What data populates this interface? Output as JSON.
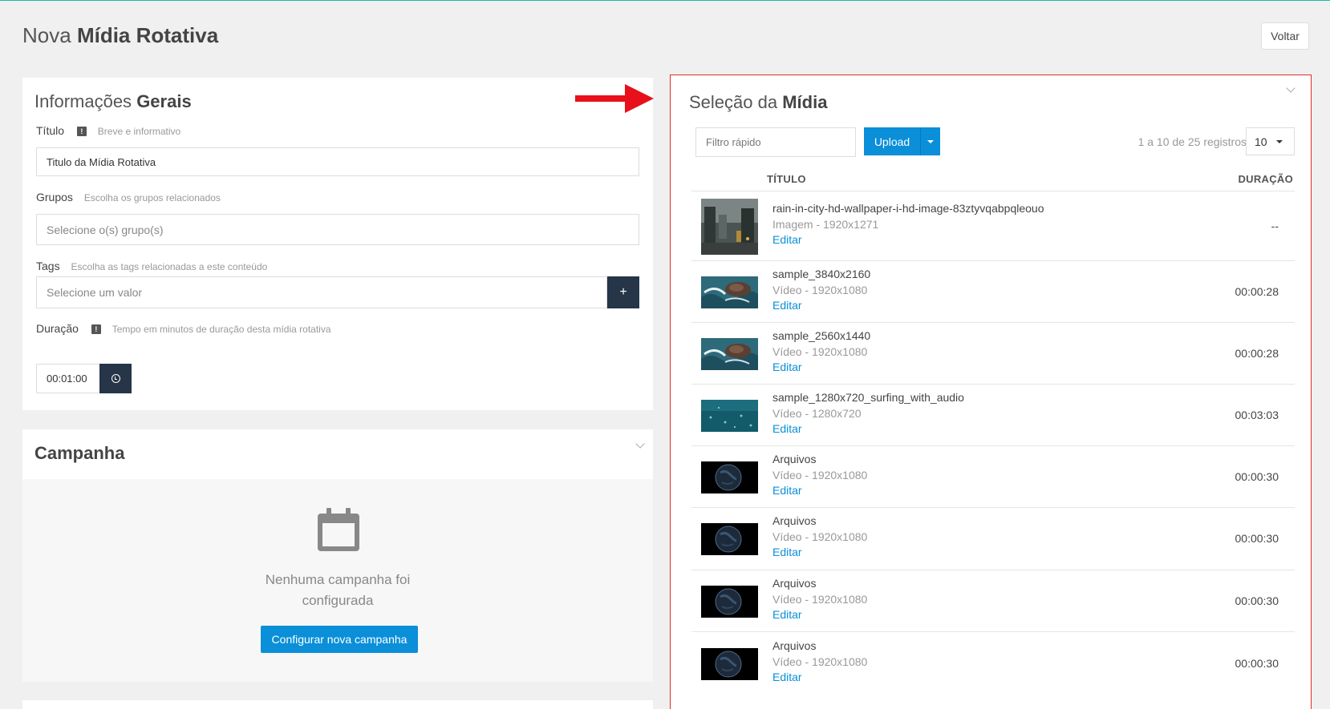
{
  "header": {
    "title_light": "Nova",
    "title_bold": "Mídia Rotativa",
    "back_label": "Voltar"
  },
  "general": {
    "title_light": "Informações",
    "title_bold": "Gerais",
    "titulo_label": "Título",
    "titulo_hint": "Breve e informativo",
    "titulo_value": "Titulo da Mídia Rotativa",
    "grupos_label": "Grupos",
    "grupos_hint": "Escolha os grupos relacionados",
    "grupos_placeholder": "Selecione o(s) grupo(s)",
    "tags_label": "Tags",
    "tags_hint": "Escolha as tags relacionadas a este conteúdo",
    "tags_placeholder": "Selecione um valor",
    "tags_add": "+",
    "duracao_label": "Duração",
    "duracao_hint": "Tempo em minutos de duração desta mídia rotativa",
    "duracao_value": "00:01:00",
    "info_glyph": "!"
  },
  "campaign": {
    "title": "Campanha",
    "empty_line1": "Nenhuma campanha foi",
    "empty_line2": "configurada",
    "configure_label": "Configurar nova campanha"
  },
  "media": {
    "title_light": "Seleção da",
    "title_bold": "Mídia",
    "filter_placeholder": "Filtro rápido",
    "upload_label": "Upload",
    "records_text": "1 a 10 de 25 registros",
    "per_page": "10",
    "col_title": "TÍTULO",
    "col_duration": "DURAÇÃO",
    "edit_label": "Editar",
    "items": [
      {
        "title": "rain-in-city-hd-wallpaper-i-hd-image-83ztyvqabpqleouo",
        "sub": "Imagem - 1920x1271",
        "duration": "--",
        "thumb": "city"
      },
      {
        "title": "sample_3840x2160",
        "sub": "Vídeo - 1920x1080",
        "duration": "00:00:28",
        "thumb": "waves"
      },
      {
        "title": "sample_2560x1440",
        "sub": "Vídeo - 1920x1080",
        "duration": "00:00:28",
        "thumb": "waves"
      },
      {
        "title": "sample_1280x720_surfing_with_audio",
        "sub": "Vídeo - 1280x720",
        "duration": "00:03:03",
        "thumb": "ocean"
      },
      {
        "title": "Arquivos",
        "sub": "Vídeo - 1920x1080",
        "duration": "00:00:30",
        "thumb": "earth"
      },
      {
        "title": "Arquivos",
        "sub": "Vídeo - 1920x1080",
        "duration": "00:00:30",
        "thumb": "earth"
      },
      {
        "title": "Arquivos",
        "sub": "Vídeo - 1920x1080",
        "duration": "00:00:30",
        "thumb": "earth"
      },
      {
        "title": "Arquivos",
        "sub": "Vídeo - 1920x1080",
        "duration": "00:00:30",
        "thumb": "earth"
      }
    ]
  },
  "colors": {
    "accent": "#0a8fd8",
    "dark_button": "#263548",
    "highlight_border": "#e12b2b"
  }
}
